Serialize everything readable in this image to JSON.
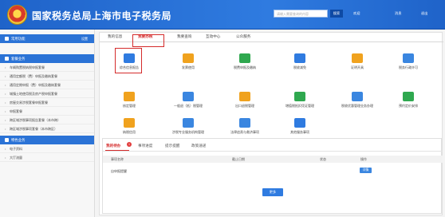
{
  "header": {
    "title": "国家税务总局上海市电子税务局",
    "search_placeholder": "请输入需要查询的内容",
    "search_label": "搜索",
    "user": "欢迎",
    "messages": "消息",
    "logout": "退出"
  },
  "sidebar": {
    "common_title": "常用功能",
    "settings": "设置",
    "favorites_title": "套餐业务",
    "items": [
      "车辆购置税纳税申报套餐",
      "通用定额税（费）申报及缴纳套餐",
      "通用定期申报（费）申报及缴纳套餐",
      "城镇土地使用税及房产税申报套餐",
      "房屋交易涉税套餐申报套餐",
      "申报套餐",
      "跨区域涉税事项报告套餐（本市跨）",
      "跨区域涉税事项套餐（本市跨区）"
    ],
    "special_title": "特色业务",
    "special_items": [
      "电子资料",
      "大厅流量"
    ]
  },
  "tabs": [
    "我的信息",
    "我要办税",
    "我要查询",
    "互动中心",
    "公众服务"
  ],
  "grid": [
    {
      "label": "综合信息报告",
      "icon": "doc-report-icon",
      "color": "#2f7be0"
    },
    {
      "label": "发票使用",
      "icon": "invoice-icon",
      "color": "#f0a21e"
    },
    {
      "label": "税费申报及缴纳",
      "icon": "tax-declare-icon",
      "color": "#2fa84f"
    },
    {
      "label": "税收减免",
      "icon": "tax-relief-icon",
      "color": "#2f7be0"
    },
    {
      "label": "证明开具",
      "icon": "certificate-icon",
      "color": "#f0a21e"
    },
    {
      "label": "税务行政许可",
      "icon": "permit-icon",
      "color": "#3a86e0"
    },
    {
      "label": "核定管理",
      "icon": "approval-icon",
      "color": "#f0a21e"
    },
    {
      "label": "一般退（抵）税管理",
      "icon": "refund-icon",
      "color": "#3a86e0"
    },
    {
      "label": "出口退税管理",
      "icon": "export-refund-icon",
      "color": "#f0a21e"
    },
    {
      "label": "增值税抵扣凭证管理",
      "icon": "vat-voucher-icon",
      "color": "#2fa84f"
    },
    {
      "label": "税收优惠管理业务办理",
      "icon": "tax-benefit-icon",
      "color": "#3a86e0"
    },
    {
      "label": "预约定价安排",
      "icon": "pricing-icon",
      "color": "#2fa84f"
    },
    {
      "label": "纳税信用",
      "icon": "credit-icon",
      "color": "#f0a21e"
    },
    {
      "label": "涉税专业服务机构管理",
      "icon": "agency-icon",
      "color": "#3a86e0"
    },
    {
      "label": "法律追责与救济事项",
      "icon": "legal-icon",
      "color": "#3a86e0"
    },
    {
      "label": "其他服务事项",
      "icon": "other-service-icon",
      "color": "#2f7be0"
    }
  ],
  "lower": {
    "tabs": [
      "我的待办",
      "事项进度",
      "提示提醒",
      "政策速递"
    ],
    "badge": "1",
    "headers": [
      "事项名称",
      "截止日期",
      "状态",
      "操作"
    ],
    "row": {
      "name": "自申报提醒",
      "deadline": "",
      "status": "",
      "action": "详情"
    },
    "more": "更多"
  }
}
